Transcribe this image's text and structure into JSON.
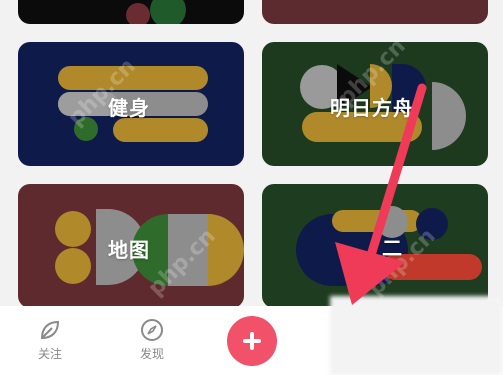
{
  "cards": {
    "fitness": {
      "label": "健身"
    },
    "tomorrow": {
      "label": "明日方舟"
    },
    "map": {
      "label": "地图"
    },
    "bottom_right": {
      "label": "二"
    }
  },
  "tabbar": {
    "follow": {
      "label": "关注",
      "icon": "leaf-icon"
    },
    "discover": {
      "label": "发现",
      "icon": "compass-icon"
    },
    "add": {
      "icon": "plus-icon",
      "color": "#f2516a"
    }
  },
  "overlay": {
    "arrow_color": "#ef3b57"
  },
  "watermark": {
    "text": "php.cn"
  }
}
